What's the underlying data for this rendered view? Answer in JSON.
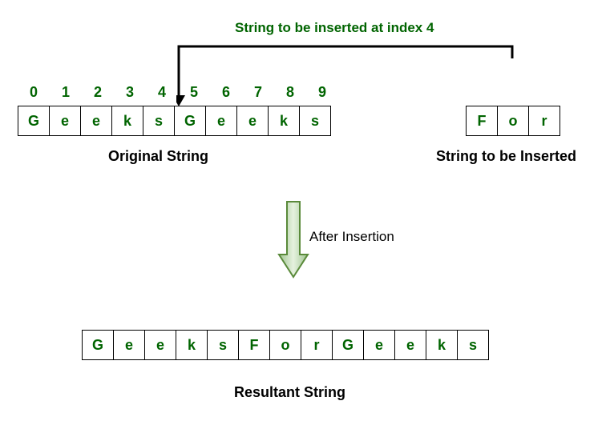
{
  "title": "String to be inserted at index 4",
  "labels": {
    "original": "Original String",
    "insert": "String to be Inserted",
    "after": "After Insertion",
    "result": "Resultant String"
  },
  "original": {
    "indices": [
      "0",
      "1",
      "2",
      "3",
      "4",
      "5",
      "6",
      "7",
      "8",
      "9"
    ],
    "chars": [
      "G",
      "e",
      "e",
      "k",
      "s",
      "G",
      "e",
      "e",
      "k",
      "s"
    ]
  },
  "insert": {
    "chars": [
      "F",
      "o",
      "r"
    ]
  },
  "result": {
    "chars": [
      "G",
      "e",
      "e",
      "k",
      "s",
      "F",
      "o",
      "r",
      "G",
      "e",
      "e",
      "k",
      "s"
    ]
  },
  "chart_data": {
    "type": "table",
    "original_string": "GeeksGeeks",
    "insert_string": "For",
    "insert_after_index": 4,
    "result_string": "GeeksForGeeks"
  }
}
